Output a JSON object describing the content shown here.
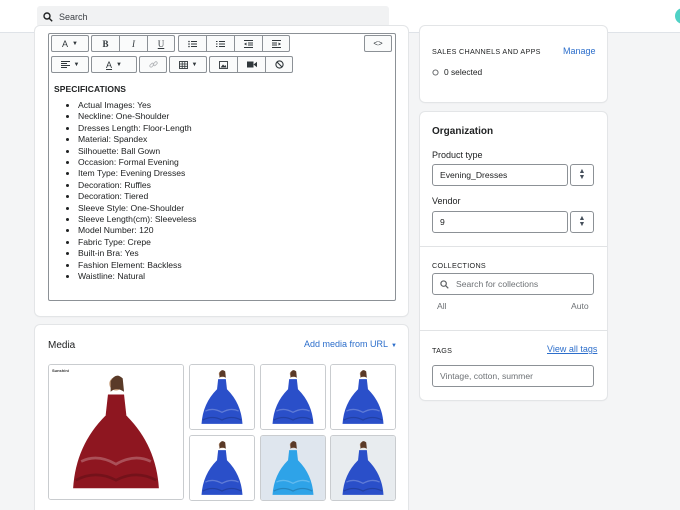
{
  "topbar": {
    "search_placeholder": "Search"
  },
  "editor": {
    "toolbar_row1": [
      {
        "name": "heading-style-button",
        "label": "A",
        "caret": true,
        "icon": "text-style-icon"
      },
      {
        "name": "bold-button",
        "label": "B",
        "icon": "bold-icon"
      },
      {
        "name": "italic-button",
        "label": "I",
        "icon": "italic-icon"
      },
      {
        "name": "underline-button",
        "label": "U",
        "icon": "underline-icon"
      },
      {
        "name": "bullet-list-button",
        "label": "",
        "icon": "bullet-list-icon"
      },
      {
        "name": "numbered-list-button",
        "label": "",
        "icon": "numbered-list-icon"
      },
      {
        "name": "outdent-button",
        "label": "",
        "icon": "outdent-icon"
      },
      {
        "name": "indent-button",
        "label": "",
        "icon": "indent-icon"
      }
    ],
    "toolbar_row2": [
      {
        "name": "align-button",
        "icon": "align-left-icon"
      },
      {
        "name": "text-color-button",
        "label": "A",
        "icon": "text-color-icon"
      },
      {
        "name": "link-button",
        "icon": "link-icon"
      },
      {
        "name": "table-button",
        "icon": "table-icon"
      },
      {
        "name": "image-button",
        "icon": "image-icon"
      },
      {
        "name": "video-button",
        "icon": "video-icon"
      },
      {
        "name": "clear-format-button",
        "icon": "clear-format-icon"
      }
    ],
    "code_label": "<>",
    "heading": "SPECIFICATIONS",
    "items": [
      "Actual Images: Yes",
      "Neckline: One-Shoulder",
      "Dresses Length: Floor-Length",
      "Material: Spandex",
      "Silhouette: Ball Gown",
      "Occasion: Formal Evening",
      "Item Type: Evening Dresses",
      "Decoration: Ruffles",
      "Decoration: Tiered",
      "Sleeve Style: One-Shoulder",
      "Sleeve Length(cm): Sleeveless",
      "Model Number: 120",
      "Fabric Type: Crepe",
      "Built-in Bra: Yes",
      "Fashion Element: Backless",
      "Waistline: Natural"
    ]
  },
  "media": {
    "title": "Media",
    "add_link": "Add media from URL",
    "brand_text": "Sunshini",
    "thumbs": [
      {
        "color": "#8e1620",
        "bg": "#ffffff"
      },
      {
        "color": "#2a4fc9",
        "bg": "#ffffff"
      },
      {
        "color": "#2a4fc9",
        "bg": "#ffffff"
      },
      {
        "color": "#2a4fc9",
        "bg": "#ffffff"
      },
      {
        "color": "#2a4fc9",
        "bg": "#ffffff"
      },
      {
        "color": "#2ea3e8",
        "bg": "#dfe6ee"
      },
      {
        "color": "#2a4fc9",
        "bg": "#e8ecef"
      }
    ]
  },
  "sales": {
    "heading": "SALES CHANNELS AND APPS",
    "manage": "Manage",
    "selected": "0 selected"
  },
  "organization": {
    "title": "Organization",
    "product_type_label": "Product type",
    "product_type_value": "Evening_Dresses",
    "vendor_label": "Vendor",
    "vendor_value": "9",
    "collections_heading": "COLLECTIONS",
    "collections_placeholder": "Search for collections",
    "all_label": "All",
    "auto_label": "Auto",
    "tags_heading": "TAGS",
    "view_all_tags": "View all tags",
    "tags_placeholder": "Vintage, cotton, summer"
  },
  "colors": {
    "accent": "#2c6ecb",
    "border": "#8c9196"
  }
}
